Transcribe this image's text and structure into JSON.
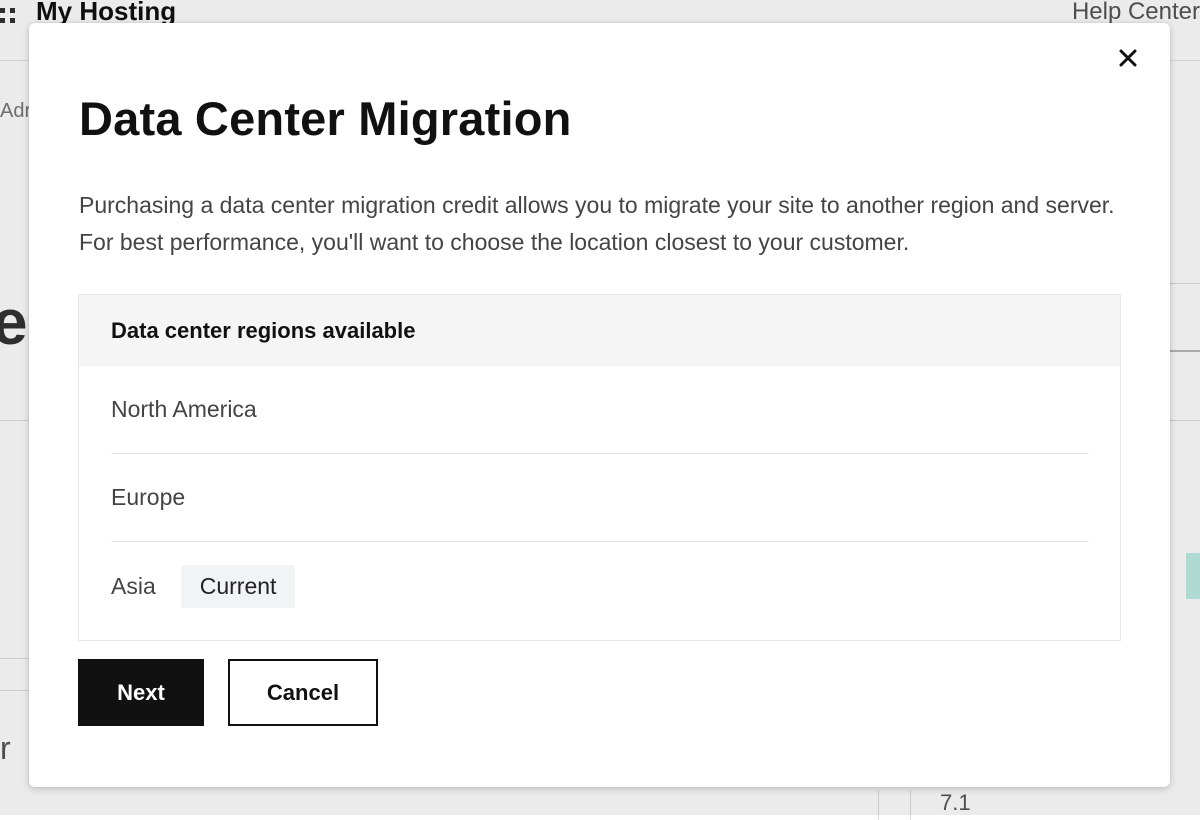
{
  "background": {
    "app_title": "My Hosting",
    "help_link": "Help Center",
    "fragment_adr": "Adr",
    "fragment_big": "ec",
    "fragment_r": "r",
    "fragment_version": "7.1"
  },
  "modal": {
    "title": "Data Center Migration",
    "description": "Purchasing a data center migration credit allows you to migrate your site to another region and server. For best performance, you'll want to choose the location closest to your customer.",
    "close_icon": "close-icon",
    "regions": {
      "header": "Data center regions available",
      "items": [
        {
          "name": "North America",
          "badge": ""
        },
        {
          "name": "Europe",
          "badge": ""
        },
        {
          "name": "Asia",
          "badge": "Current"
        }
      ]
    },
    "buttons": {
      "next": "Next",
      "cancel": "Cancel"
    }
  },
  "colors": {
    "primary_button": "#111111",
    "header_row_bg": "#f5f5f5",
    "badge_bg": "#f1f3f5"
  }
}
